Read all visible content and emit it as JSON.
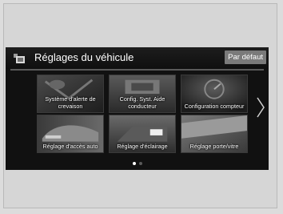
{
  "header": {
    "title": "Réglages du véhicule",
    "default_button": "Par défaut"
  },
  "tiles": [
    {
      "label": "Système d'alerte de crevaison"
    },
    {
      "label": "Config. Syst. Aide conducteur"
    },
    {
      "label": "Configuration compteur"
    },
    {
      "label": "Réglage d'accès auto"
    },
    {
      "label": "Réglage d'éclairage"
    },
    {
      "label": "Réglage porte/vitre"
    }
  ],
  "pager": {
    "current_page": 1,
    "total_pages": 2
  },
  "icons": {
    "header": "settings-car-icon",
    "next": "chevron-right-icon"
  }
}
